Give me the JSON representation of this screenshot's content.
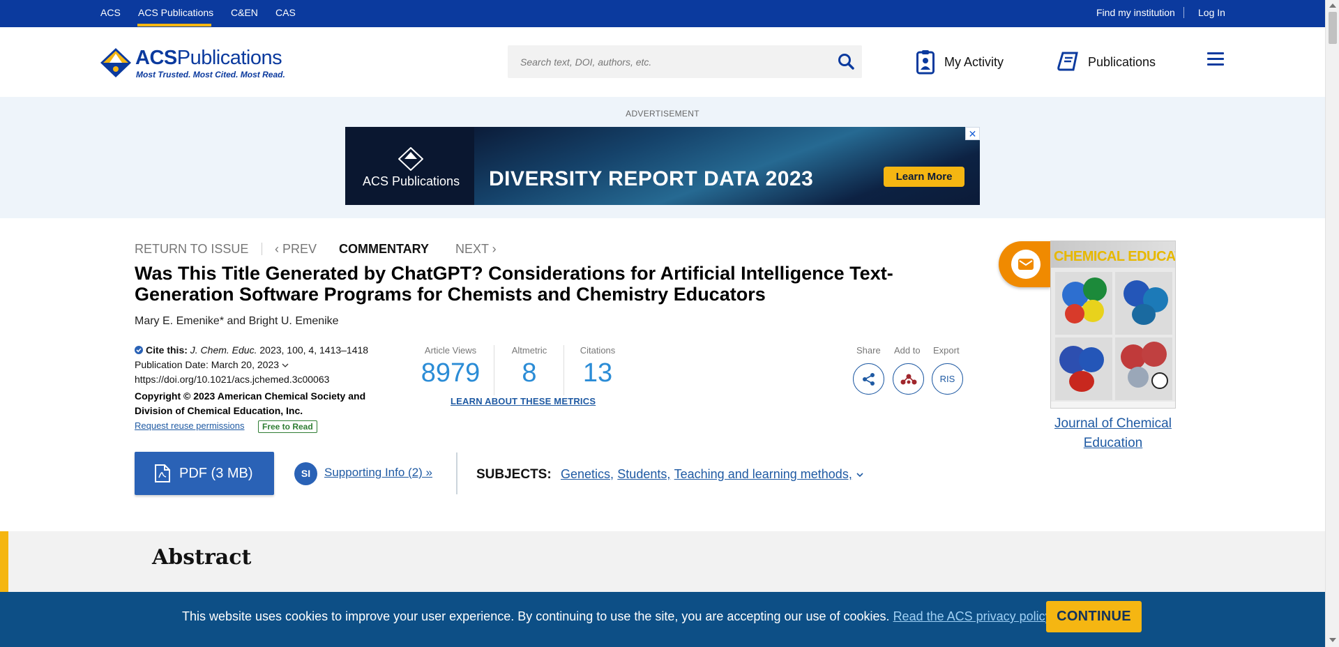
{
  "topbar": {
    "links": [
      "ACS",
      "ACS Publications",
      "C&EN",
      "CAS"
    ],
    "active": "ACS Publications",
    "find_institution": "Find my institution",
    "login": "Log In"
  },
  "header": {
    "logo_title_bold": "ACS",
    "logo_title_rest": "Publications",
    "logo_tagline": "Most Trusted. Most Cited. Most Read.",
    "search_placeholder": "Search text, DOI, authors, etc.",
    "my_activity": "My Activity",
    "publications": "Publications"
  },
  "ad": {
    "label": "ADVERTISEMENT",
    "brand": "ACS Publications",
    "headline": "DIVERSITY REPORT DATA 2023",
    "button": "Learn More",
    "close": "✕"
  },
  "article_nav": {
    "return": "RETURN TO ISSUE",
    "prev": "‹ PREV",
    "type": "COMMENTARY",
    "next": "NEXT ›"
  },
  "article": {
    "title": "Was This Title Generated by ChatGPT? Considerations for Artificial Intelligence Text-Generation Software Programs for Chemists and Chemistry Educators",
    "authors": "Mary E. Emenike* and Bright U. Emenike",
    "cite_label": "Cite this:",
    "cite_journal": "J. Chem. Educ.",
    "cite_details": "2023, 100, 4, 1413–1418",
    "pub_date": "Publication Date: March 20, 2023",
    "doi": "https://doi.org/10.1021/acs.jchemed.3c00063",
    "copyright": "Copyright © 2023 American Chemical Society and Division of Chemical Education, Inc.",
    "reuse": "Request reuse permissions",
    "free_badge": "Free to Read"
  },
  "metrics": {
    "items": [
      {
        "label": "Article Views",
        "value": "8979"
      },
      {
        "label": "Altmetric",
        "value": "8"
      },
      {
        "label": "Citations",
        "value": "13"
      }
    ],
    "learn_more": "LEARN ABOUT THESE METRICS"
  },
  "actions": {
    "share": "Share",
    "add_to": "Add to",
    "export": "Export",
    "ris": "RIS"
  },
  "downloads": {
    "pdf": "PDF (3 MB)",
    "si_badge": "SI",
    "supporting_info": "Supporting Info (2) »"
  },
  "subjects": {
    "label": "SUBJECTS:",
    "items": [
      "Genetics,",
      "Students,",
      "Teaching and learning methods,"
    ]
  },
  "sidebar": {
    "cover_title": "CHEMICAL EDUCATION",
    "journal_name": "Journal of Chemical Education"
  },
  "abstract": {
    "heading": "Abstract"
  },
  "cookie": {
    "text": "This website uses cookies to improve your user experience. By continuing to use the site, you are accepting our use of cookies.",
    "link": "Read the ACS privacy policy",
    "period": ".",
    "button": "CONTINUE"
  },
  "colors": {
    "brand_blue": "#0b3a9e",
    "accent_gold": "#f5b612",
    "link_blue": "#1f5aa3",
    "metric_blue": "#2b8cd6",
    "cookie_bg": "#0d4f86",
    "email_orange": "#f08a00"
  }
}
